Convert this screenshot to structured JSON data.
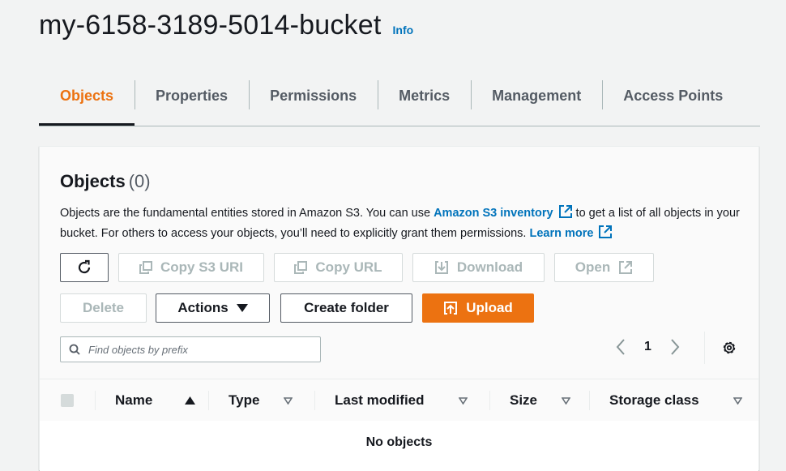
{
  "bucket": {
    "name": "my-6158-3189-5014-bucket",
    "info_label": "Info"
  },
  "tabs": [
    {
      "label": "Objects",
      "active": true
    },
    {
      "label": "Properties"
    },
    {
      "label": "Permissions"
    },
    {
      "label": "Metrics"
    },
    {
      "label": "Management"
    },
    {
      "label": "Access Points"
    }
  ],
  "objects_panel": {
    "title": "Objects",
    "count": "(0)",
    "description": {
      "part1": "Objects are the fundamental entities stored in Amazon S3. You can use ",
      "link1": "Amazon S3 inventory",
      "part2": " to get a list of all objects in your bucket. For others to access your objects, you’ll need to explicitly grant them permissions. ",
      "link2": "Learn more"
    },
    "buttons": {
      "copy_uri": "Copy S3 URI",
      "copy_url": "Copy URL",
      "download": "Download",
      "open": "Open",
      "delete": "Delete",
      "actions": "Actions",
      "create_folder": "Create folder",
      "upload": "Upload"
    },
    "search": {
      "placeholder": "Find objects by prefix",
      "value": ""
    },
    "pagination": {
      "current_page": "1"
    },
    "table": {
      "columns": [
        "Name",
        "Type",
        "Last modified",
        "Size",
        "Storage class"
      ],
      "sorted_column": "Name",
      "empty_message": "No objects"
    }
  },
  "colors": {
    "accent": "#ec7211",
    "link": "#0073bb",
    "text": "#16191f",
    "muted": "#545b64"
  },
  "icons": [
    "refresh-icon",
    "copy-icon",
    "download-icon",
    "external-link-icon",
    "caret-down-icon",
    "upload-icon",
    "search-icon",
    "chevron-left-icon",
    "chevron-right-icon",
    "settings-gear-icon",
    "sort-ascending-icon",
    "sort-icon"
  ]
}
